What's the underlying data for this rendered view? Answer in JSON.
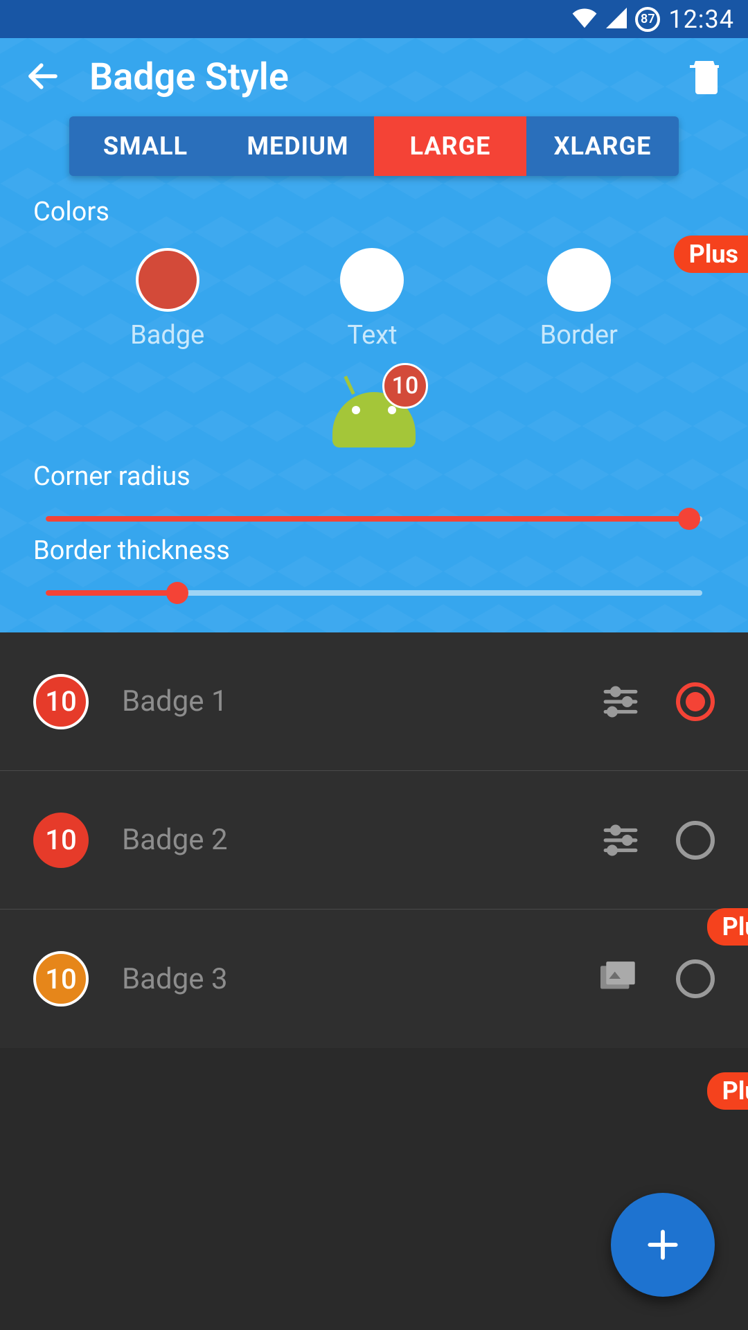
{
  "status_bar": {
    "battery_level": "87",
    "time": "12:34"
  },
  "app_bar": {
    "title": "Badge Style"
  },
  "size_tabs": {
    "options": [
      "SMALL",
      "MEDIUM",
      "LARGE",
      "XLARGE"
    ],
    "active_index": 2
  },
  "sections": {
    "colors_label": "Colors",
    "corner_radius_label": "Corner radius",
    "border_thickness_label": "Border thickness"
  },
  "plus_label": "Plus",
  "color_swatches": {
    "badge": {
      "label": "Badge",
      "color": "#d34a39"
    },
    "text": {
      "label": "Text",
      "color": "#ffffff"
    },
    "border": {
      "label": "Border",
      "color": "#ffffff"
    }
  },
  "preview": {
    "badge_count": "10"
  },
  "sliders": {
    "corner_radius_percent": 98,
    "border_thickness_percent": 20
  },
  "badge_list": [
    {
      "label": "Badge 1",
      "count": "10",
      "chip_color": "#e63b2a",
      "has_border": true,
      "icon": "sliders",
      "selected": true
    },
    {
      "label": "Badge 2",
      "count": "10",
      "chip_color": "#e63b2a",
      "has_border": false,
      "icon": "sliders",
      "selected": false
    },
    {
      "label": "Badge 3",
      "count": "10",
      "chip_color": "#e6861a",
      "has_border": true,
      "icon": "images",
      "selected": false
    }
  ]
}
